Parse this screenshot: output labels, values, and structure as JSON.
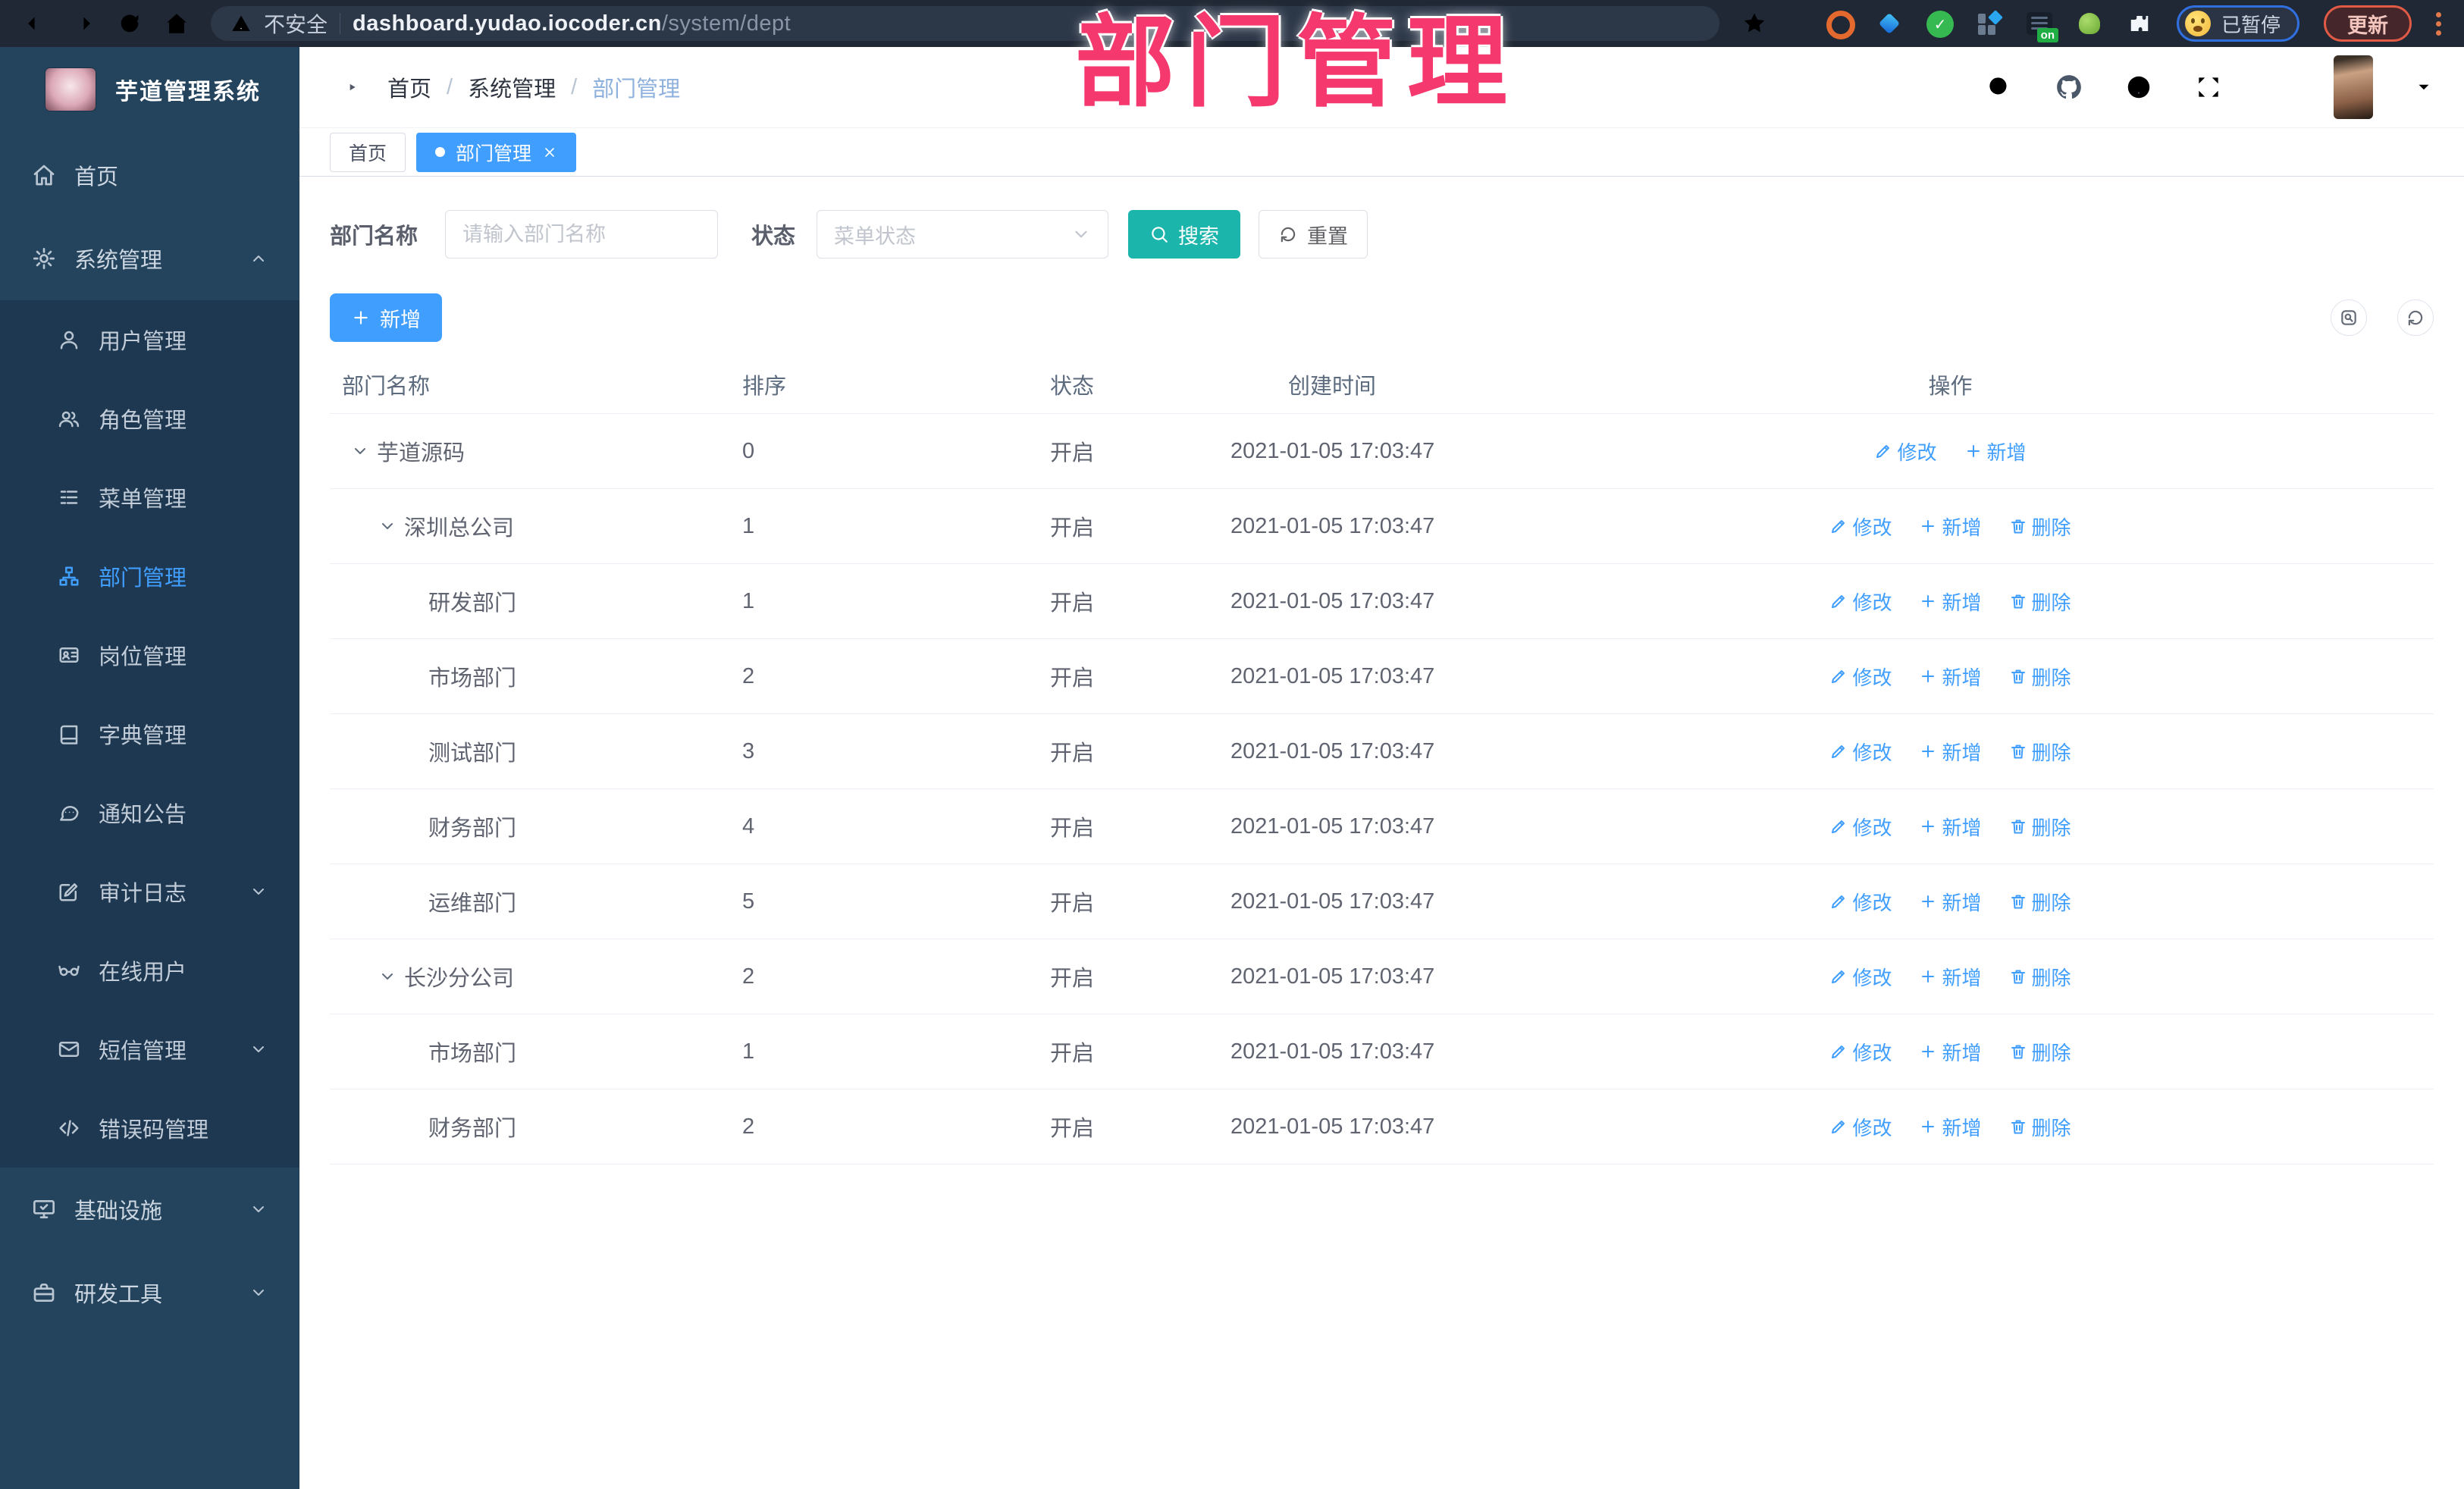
{
  "browser": {
    "security_label": "不安全",
    "url_host": "dashboard.yudao.iocoder.cn",
    "url_path": "/system/dept",
    "extension_badge": "on",
    "profile_label": "已暂停",
    "update_label": "更新"
  },
  "overlay_title": "部门管理",
  "sidebar": {
    "app_title": "芋道管理系统",
    "menu": [
      {
        "icon": "home",
        "label": "首页",
        "level": 0
      },
      {
        "icon": "gear",
        "label": "系统管理",
        "level": 0,
        "chevron": "up"
      },
      {
        "icon": "user",
        "label": "用户管理",
        "level": 1
      },
      {
        "icon": "users",
        "label": "角色管理",
        "level": 1
      },
      {
        "icon": "list",
        "label": "菜单管理",
        "level": 1
      },
      {
        "icon": "tree",
        "label": "部门管理",
        "level": 1,
        "active": true
      },
      {
        "icon": "idcard",
        "label": "岗位管理",
        "level": 1
      },
      {
        "icon": "book",
        "label": "字典管理",
        "level": 1
      },
      {
        "icon": "chat",
        "label": "通知公告",
        "level": 1
      },
      {
        "icon": "editlog",
        "label": "审计日志",
        "level": 1,
        "chevron": "down"
      },
      {
        "icon": "glasses",
        "label": "在线用户",
        "level": 1
      },
      {
        "icon": "sms",
        "label": "短信管理",
        "level": 1,
        "chevron": "down"
      },
      {
        "icon": "code",
        "label": "错误码管理",
        "level": 1
      },
      {
        "icon": "monitor",
        "label": "基础设施",
        "level": 0,
        "chevron": "down"
      },
      {
        "icon": "toolbox",
        "label": "研发工具",
        "level": 0,
        "chevron": "down"
      }
    ]
  },
  "header": {
    "breadcrumb": [
      "首页",
      "系统管理",
      "部门管理"
    ]
  },
  "tabs": [
    {
      "label": "首页",
      "active": false
    },
    {
      "label": "部门管理",
      "active": true
    }
  ],
  "filter": {
    "name_label": "部门名称",
    "name_placeholder": "请输入部门名称",
    "status_label": "状态",
    "status_placeholder": "菜单状态",
    "search_label": "搜索",
    "reset_label": "重置"
  },
  "toolbar": {
    "add_label": "新增"
  },
  "table": {
    "columns": [
      "部门名称",
      "排序",
      "状态",
      "创建时间",
      "操作"
    ],
    "action_labels": {
      "edit": "修改",
      "add": "新增",
      "delete": "删除"
    },
    "rows": [
      {
        "name": "芋道源码",
        "level": 0,
        "expandable": true,
        "sort": "0",
        "status": "开启",
        "created": "2021-01-05 17:03:47",
        "actions": [
          "edit",
          "add"
        ]
      },
      {
        "name": "深圳总公司",
        "level": 1,
        "expandable": true,
        "sort": "1",
        "status": "开启",
        "created": "2021-01-05 17:03:47",
        "actions": [
          "edit",
          "add",
          "delete"
        ]
      },
      {
        "name": "研发部门",
        "level": 2,
        "expandable": false,
        "sort": "1",
        "status": "开启",
        "created": "2021-01-05 17:03:47",
        "actions": [
          "edit",
          "add",
          "delete"
        ]
      },
      {
        "name": "市场部门",
        "level": 2,
        "expandable": false,
        "sort": "2",
        "status": "开启",
        "created": "2021-01-05 17:03:47",
        "actions": [
          "edit",
          "add",
          "delete"
        ]
      },
      {
        "name": "测试部门",
        "level": 2,
        "expandable": false,
        "sort": "3",
        "status": "开启",
        "created": "2021-01-05 17:03:47",
        "actions": [
          "edit",
          "add",
          "delete"
        ]
      },
      {
        "name": "财务部门",
        "level": 2,
        "expandable": false,
        "sort": "4",
        "status": "开启",
        "created": "2021-01-05 17:03:47",
        "actions": [
          "edit",
          "add",
          "delete"
        ]
      },
      {
        "name": "运维部门",
        "level": 2,
        "expandable": false,
        "sort": "5",
        "status": "开启",
        "created": "2021-01-05 17:03:47",
        "actions": [
          "edit",
          "add",
          "delete"
        ]
      },
      {
        "name": "长沙分公司",
        "level": 1,
        "expandable": true,
        "sort": "2",
        "status": "开启",
        "created": "2021-01-05 17:03:47",
        "actions": [
          "edit",
          "add",
          "delete"
        ]
      },
      {
        "name": "市场部门",
        "level": 2,
        "expandable": false,
        "sort": "1",
        "status": "开启",
        "created": "2021-01-05 17:03:47",
        "actions": [
          "edit",
          "add",
          "delete"
        ]
      },
      {
        "name": "财务部门",
        "level": 2,
        "expandable": false,
        "sort": "2",
        "status": "开启",
        "created": "2021-01-05 17:03:47",
        "actions": [
          "edit",
          "add",
          "delete"
        ]
      }
    ]
  },
  "colors": {
    "accent_blue": "#409EFF",
    "search_teal": "#1cb5ac",
    "overlay_pink": "#f5386e",
    "sidebar_bg": "#24445e",
    "submenu_bg": "#1d3850",
    "browser_bar_bg": "#1f2834"
  }
}
